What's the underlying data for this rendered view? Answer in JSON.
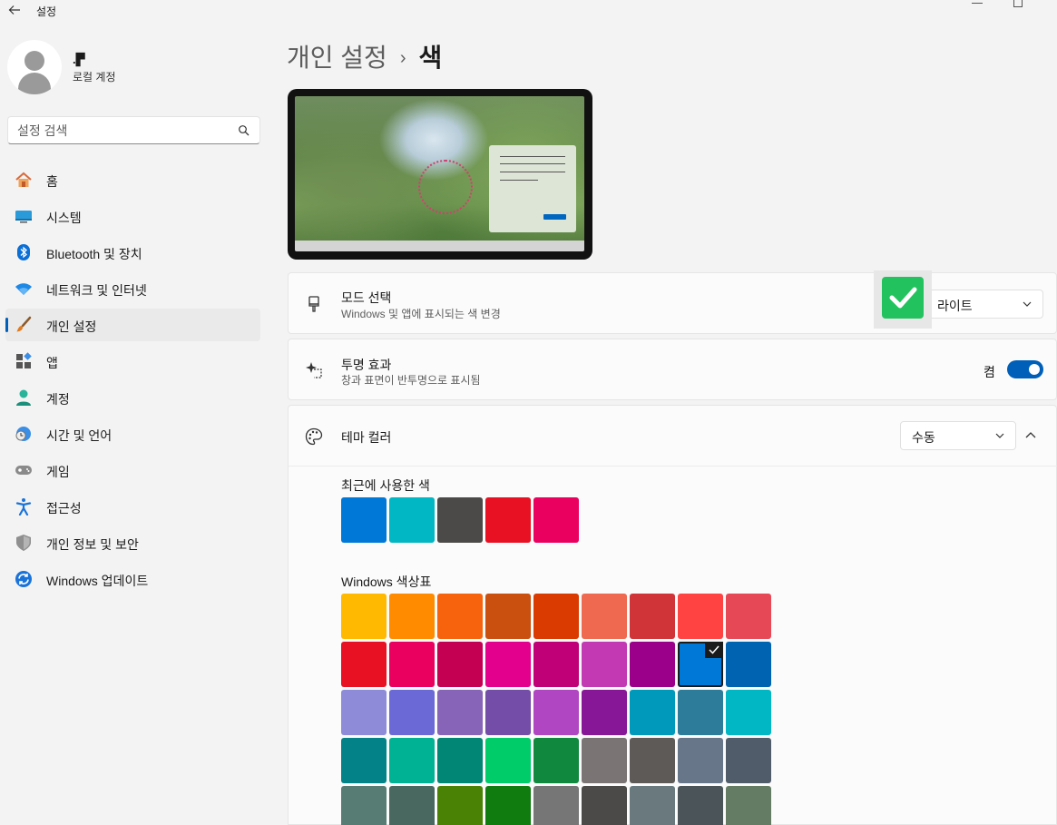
{
  "window": {
    "title": "설정",
    "back_icon": "arrow-left-icon"
  },
  "profile": {
    "name": ".▛",
    "subtitle": "로컬 계정"
  },
  "search": {
    "placeholder": "설정 검색",
    "icon": "search-icon"
  },
  "sidebar": {
    "active_index": 4,
    "items": [
      {
        "label": "홈",
        "icon": "home-icon"
      },
      {
        "label": "시스템",
        "icon": "system-icon"
      },
      {
        "label": "Bluetooth 및 장치",
        "icon": "bluetooth-icon"
      },
      {
        "label": "네트워크 및 인터넷",
        "icon": "wifi-icon"
      },
      {
        "label": "개인 설정",
        "icon": "paintbrush-icon"
      },
      {
        "label": "앱",
        "icon": "apps-icon"
      },
      {
        "label": "계정",
        "icon": "account-icon"
      },
      {
        "label": "시간 및 언어",
        "icon": "clock-globe-icon"
      },
      {
        "label": "게임",
        "icon": "gamepad-icon"
      },
      {
        "label": "접근성",
        "icon": "accessibility-icon"
      },
      {
        "label": "개인 정보 및 보안",
        "icon": "shield-icon"
      },
      {
        "label": "Windows 업데이트",
        "icon": "update-icon"
      }
    ]
  },
  "breadcrumb": {
    "parent": "개인 설정",
    "separator": "›",
    "current": "색"
  },
  "mode": {
    "title": "모드 선택",
    "description": "Windows 및 앱에 표시되는 색 변경",
    "value": "라이트"
  },
  "transparency": {
    "title": "투명 효과",
    "description": "창과 표면이 반투명으로 표시됨",
    "state_label": "켬",
    "on": true
  },
  "theme_color": {
    "title": "테마 컬러",
    "value": "수동",
    "recent_label": "최근에 사용한 색",
    "recent": [
      "#0078d7",
      "#00b7c3",
      "#4c4a48",
      "#e81123",
      "#ea005e"
    ],
    "palette_label": "Windows 색상표",
    "selected": "#0078d7",
    "palette": [
      [
        "#ffb900",
        "#ff8c00",
        "#f7630c",
        "#ca5010",
        "#da3b01",
        "#ef6950",
        "#d13438",
        "#ff4343",
        "#e74856"
      ],
      [
        "#e81123",
        "#ea005e",
        "#c30052",
        "#e3008c",
        "#bf0077",
        "#c239b3",
        "#9a0089",
        "#0078d7",
        "#0063b1"
      ],
      [
        "#8e8cd8",
        "#6b69d6",
        "#8764b8",
        "#744da9",
        "#b146c2",
        "#881798",
        "#0099bc",
        "#2d7d9a",
        "#00b7c3"
      ],
      [
        "#038387",
        "#00b294",
        "#018574",
        "#00cc6a",
        "#10893e",
        "#7a7574",
        "#5d5a58",
        "#68768a",
        "#515c6b"
      ],
      [
        "#567c73",
        "#486860",
        "#498205",
        "#107c10",
        "#767676",
        "#4c4a48",
        "#69797e",
        "#4a5459",
        "#647c64"
      ]
    ]
  },
  "colors": {
    "accent": "#005fb8",
    "check_badge": "#22c35e"
  }
}
